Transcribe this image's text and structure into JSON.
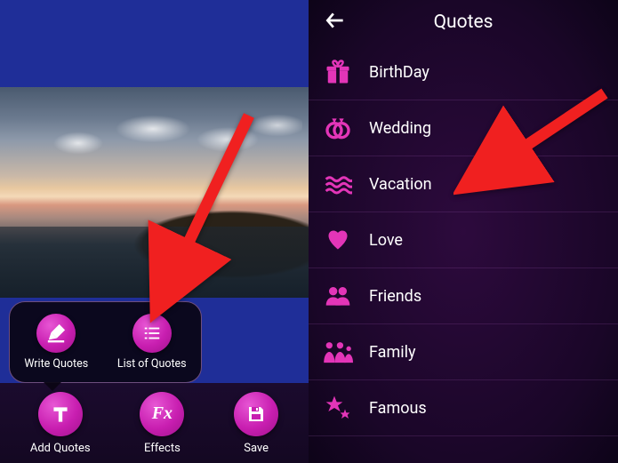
{
  "left": {
    "popup": {
      "write_label": "Write Quotes",
      "list_label": "List of Quotes"
    },
    "toolbar": {
      "add_quotes": "Add Quotes",
      "effects": "Effects",
      "save": "Save"
    }
  },
  "right": {
    "title": "Quotes",
    "categories": [
      {
        "label": "BirthDay",
        "icon": "gift"
      },
      {
        "label": "Wedding",
        "icon": "rings"
      },
      {
        "label": "Vacation",
        "icon": "waves"
      },
      {
        "label": "Love",
        "icon": "heart"
      },
      {
        "label": "Friends",
        "icon": "friends"
      },
      {
        "label": "Family",
        "icon": "family"
      },
      {
        "label": "Famous",
        "icon": "stars"
      }
    ]
  },
  "colors": {
    "accent": "#e335b8"
  }
}
